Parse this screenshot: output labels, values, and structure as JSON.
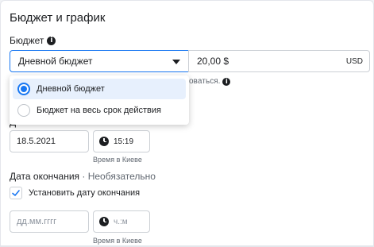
{
  "section": {
    "title": "Бюджет и график"
  },
  "budget": {
    "label": "Бюджет",
    "selected": "Дневной бюджет",
    "amount": "20,00 $",
    "currency": "USD",
    "hint": "овaться."
  },
  "dropdown": {
    "options": [
      {
        "label": "Дневной бюджет",
        "selected": true
      },
      {
        "label": "Бюджет на весь срок действия",
        "selected": false
      }
    ]
  },
  "start": {
    "label_partial": "Д",
    "date": "18.5.2021",
    "time": "15:19",
    "timezone": "Время в Киеве"
  },
  "end": {
    "label": "Дата окончания",
    "optional": " · Необязательно",
    "checkbox_label": "Установить дату окончания",
    "checkbox_checked": true,
    "date_placeholder": "дд.мм.гггг",
    "time_placeholder": "ч.:м",
    "timezone": "Время в Киеве"
  },
  "colors": {
    "accent": "#1877f2",
    "selected_bg": "#e7f0fd"
  }
}
